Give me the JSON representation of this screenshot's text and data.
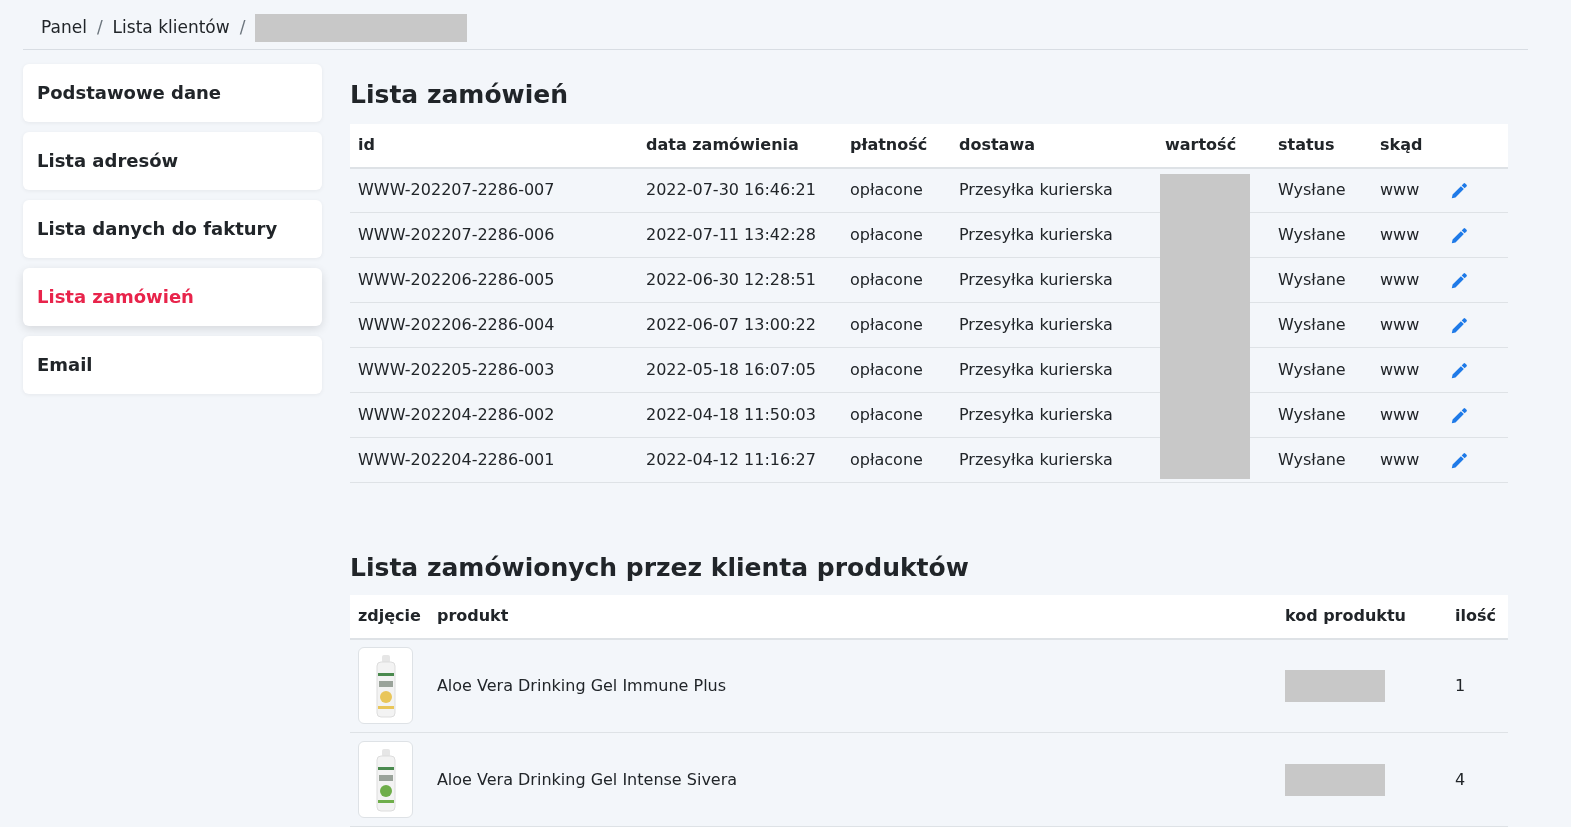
{
  "breadcrumb": [
    {
      "label": "Panel",
      "separator": "/"
    },
    {
      "label": "Lista klientów",
      "separator": "/"
    }
  ],
  "sidebar": {
    "items": [
      {
        "label": "Podstawowe dane",
        "selected": false
      },
      {
        "label": "Lista adresów",
        "selected": false
      },
      {
        "label": "Lista danych do faktury",
        "selected": false
      },
      {
        "label": "Lista zamówień",
        "selected": true
      },
      {
        "label": "Email",
        "selected": false
      }
    ]
  },
  "orders": {
    "title": "Lista zamówień",
    "columns": [
      "id",
      "data zamówienia",
      "płatność",
      "dostawa",
      "wartość",
      "status",
      "skąd"
    ],
    "rows": [
      {
        "id": "WWW-202207-2286-007",
        "date": "2022-07-30 16:46:21",
        "payment": "opłacone",
        "delivery": "Przesyłka kurierska",
        "status": "Wysłane",
        "source": "www"
      },
      {
        "id": "WWW-202207-2286-006",
        "date": "2022-07-11 13:42:28",
        "payment": "opłacone",
        "delivery": "Przesyłka kurierska",
        "status": "Wysłane",
        "source": "www"
      },
      {
        "id": "WWW-202206-2286-005",
        "date": "2022-06-30 12:28:51",
        "payment": "opłacone",
        "delivery": "Przesyłka kurierska",
        "status": "Wysłane",
        "source": "www"
      },
      {
        "id": "WWW-202206-2286-004",
        "date": "2022-06-07 13:00:22",
        "payment": "opłacone",
        "delivery": "Przesyłka kurierska",
        "status": "Wysłane",
        "source": "www"
      },
      {
        "id": "WWW-202205-2286-003",
        "date": "2022-05-18 16:07:05",
        "payment": "opłacone",
        "delivery": "Przesyłka kurierska",
        "status": "Wysłane",
        "source": "www"
      },
      {
        "id": "WWW-202204-2286-002",
        "date": "2022-04-18 11:50:03",
        "payment": "opłacone",
        "delivery": "Przesyłka kurierska",
        "status": "Wysłane",
        "source": "www"
      },
      {
        "id": "WWW-202204-2286-001",
        "date": "2022-04-12 11:16:27",
        "payment": "opłacone",
        "delivery": "Przesyłka kurierska",
        "status": "Wysłane",
        "source": "www"
      }
    ]
  },
  "products": {
    "title": "Lista zamówionych przez klienta produktów",
    "columns": [
      "zdjęcie",
      "produkt",
      "kod produktu",
      "ilość"
    ],
    "rows": [
      {
        "name": "Aloe Vera Drinking Gel Immune Plus",
        "quantity": "1"
      },
      {
        "name": "Aloe Vera Drinking Gel Intense Sivera",
        "quantity": "4"
      }
    ]
  }
}
